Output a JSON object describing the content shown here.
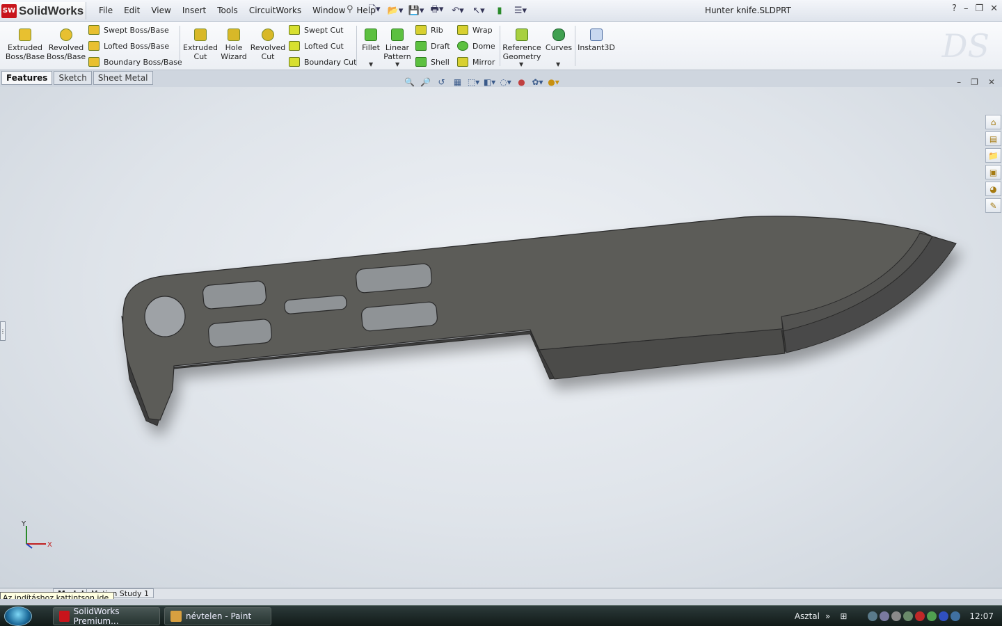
{
  "app": {
    "name": "SolidWorks",
    "logo_badge": "SW",
    "title": "Hunter knife.SLDPRT"
  },
  "menu": [
    "File",
    "Edit",
    "View",
    "Insert",
    "Tools",
    "CircuitWorks",
    "Window",
    "Help"
  ],
  "window_controls": {
    "help": "?",
    "minimize": "–",
    "restore": "❐",
    "close": "✕"
  },
  "ribbon": {
    "extruded_boss": "Extruded\nBoss/Base",
    "revolved_boss": "Revolved\nBoss/Base",
    "swept_boss": "Swept Boss/Base",
    "lofted_boss": "Lofted Boss/Base",
    "boundary_boss": "Boundary Boss/Base",
    "extruded_cut": "Extruded\nCut",
    "hole_wizard": "Hole\nWizard",
    "revolved_cut": "Revolved\nCut",
    "swept_cut": "Swept Cut",
    "lofted_cut": "Lofted Cut",
    "boundary_cut": "Boundary Cut",
    "fillet": "Fillet",
    "linear_pattern": "Linear\nPattern",
    "rib": "Rib",
    "draft": "Draft",
    "shell": "Shell",
    "wrap": "Wrap",
    "dome": "Dome",
    "mirror": "Mirror",
    "reference_geometry": "Reference\nGeometry",
    "curves": "Curves",
    "instant3d": "Instant3D"
  },
  "tabs": [
    "Features",
    "Sketch",
    "Sheet Metal"
  ],
  "active_tab": "Features",
  "triad": {
    "y": "Y",
    "x": "X"
  },
  "bottom_tabs": {
    "model": "Model",
    "motion": "Motion Study 1"
  },
  "tooltip": "Az indításhoz kattintson ide.",
  "taskbar": {
    "app1": "SolidWorks Premium...",
    "app2": "névtelen - Paint",
    "desktop": "Asztal",
    "clock": "12:07"
  },
  "colors": {
    "accent": "#c8141b",
    "model_face": "#5a5a58",
    "model_edge": "#2c2c2c"
  }
}
